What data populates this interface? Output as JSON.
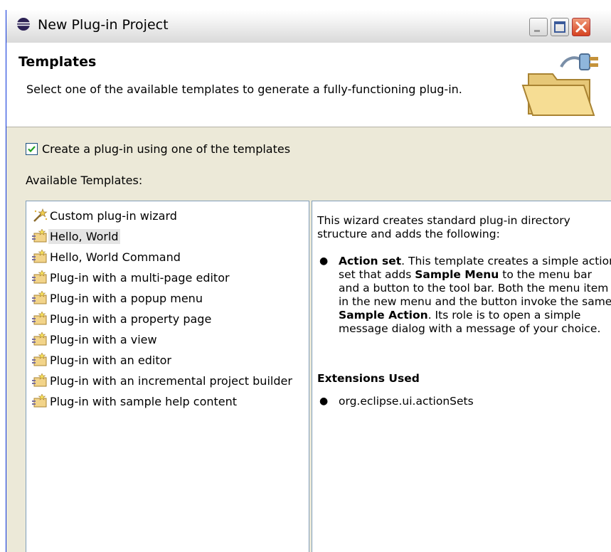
{
  "window": {
    "title": "New Plug-in Project"
  },
  "banner": {
    "title": "Templates",
    "description": "Select one of the available templates to generate a fully-functioning plug-in."
  },
  "checkbox": {
    "label": "Create a plug-in using one of the templates",
    "checked": true
  },
  "templates": {
    "label": "Available Templates:",
    "items": [
      "Custom plug-in wizard",
      "Hello, World",
      "Hello, World Command",
      "Plug-in with a multi-page editor",
      "Plug-in with a popup menu",
      "Plug-in with a property page",
      "Plug-in with a view",
      "Plug-in with an editor",
      "Plug-in with an incremental project builder",
      "Plug-in with sample help content"
    ],
    "selected": "Hello, World"
  },
  "description": {
    "intro": "This wizard creates standard plug-in directory structure and adds the following:",
    "action_set": {
      "term": "Action set",
      "text_1": ". This template creates a simple action set that adds ",
      "bold_1": "Sample Menu",
      "text_2": " to the menu bar and a button to the tool bar. Both the menu item in the new menu and the button invoke the same ",
      "bold_2": "Sample Action",
      "text_3": ". Its role is to open a simple message dialog with a message of your choice."
    },
    "extensions_title": "Extensions Used",
    "extensions": [
      "org.eclipse.ui.actionSets"
    ]
  },
  "icons": {
    "title": "eclipse-icon",
    "banner": "folder-plug-icon",
    "custom_wizard": "wizard-wand-icon",
    "template": "plugin-template-icon"
  },
  "colors": {
    "selection": "#e4e4e4",
    "close_button": "#d5421f",
    "list_border": "#7f9db9"
  }
}
